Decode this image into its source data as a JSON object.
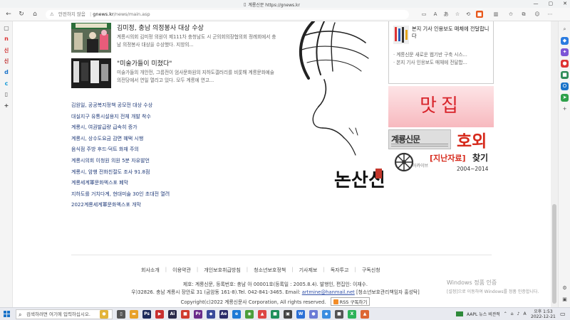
{
  "browser": {
    "tab_title": "계룡신문 https://gnews.kr",
    "security_label": "안전하지 않음",
    "url_host": "gnews.kr",
    "url_path": "/news/main.asp"
  },
  "news_items": [
    {
      "title": "김미정, 충남 의정봉사 대상 수상",
      "desc": "계룡시의회 김미정 의원이 제111차 충청남도 시 군의회의장협의회 정례회에서 충남 의정봉사 대상을 수상했다. 지방의..."
    },
    {
      "title": "\"미술가들이 미쳤다\"",
      "desc": "미술가들의 개안전, 그룹전이 엄사문화원의 지하도갤러리를 비롯해 계룡문화예술의전당에서 연일 열리고 있다. 모두 계룡에 연고..."
    }
  ],
  "headlines": [
    "김원일, 공공복지정책 공모전 대상 수상",
    "대실지구 유통시설용지 전체 개발 착수",
    "계룡시, 여권발급량 급속히 증가",
    "계룡시, 상수도요금 감면 혜택 시행",
    "음식점 주방 후드·덕트 화재 주의",
    "계룡시의회 이청원 의원 5분 자유발언",
    "계룡시, 암행 전화친절도 조사 91.8점",
    "계룡세계軍문화엑스포 폐막",
    "지하도를 거치다계, 현대미술 30인 초대전 열려",
    "2022계룡세계軍문화엑스포 개막"
  ],
  "art": {
    "calligraphy_text": "논산신문",
    "seal_text": "고완"
  },
  "right_box": {
    "lead": "본지 기사 인용보도 매체에 전달합니다",
    "items": [
      "계룡신문 새로운 웹기반 구축 시스...",
      "본지 기사 인용보도 매체에 전달합..."
    ]
  },
  "banners": {
    "majip": "맛집",
    "hoeoi_paper": "계룡신문",
    "hoeoi": "호외",
    "archive_tag": "[지난자료]",
    "archive_find": "찾기",
    "archive_small": "아카이브",
    "archive_years": "2004~2014"
  },
  "footer": {
    "menu": [
      "회사소개",
      "이용약관",
      "개인보호취급방침",
      "청소년보호정책",
      "기사제보",
      "독자투고",
      "구독신청"
    ],
    "line1": "제호: 계룡신문, 등록번호: 충남 아 00001호(등록일 : 2005.8.4). 발행인, 편집인: 이재수.",
    "line2_pre": "우)32826. 충남 계룡시 장안로 31 (금암동 161-8).Tel. 042-841-3465.   Email:",
    "email": "artmine@hanmail.net",
    "line2_post": "[청소년보호관리책임자 홍성탁]",
    "copyright": "Copyright(c)2022 계룡신문사 Corporation, All rights reserved.",
    "rss_label": "RSS 구독하기"
  },
  "watermark": {
    "line1": "Windows 정품 인증",
    "line2": "[설정]으로 이동하여 Windows를 정품 인증합니다."
  },
  "taskbar": {
    "search_placeholder": "검색하려면 여기에 입력하십시오.",
    "weather": "AAPL 뉴스 비관적",
    "time": "오후 1:53",
    "date": "2022-12-21"
  },
  "colors": {
    "headline_link": "#1f3a78",
    "majip_red": "#d8232a",
    "hoeoi_red": "#d62a1c"
  }
}
